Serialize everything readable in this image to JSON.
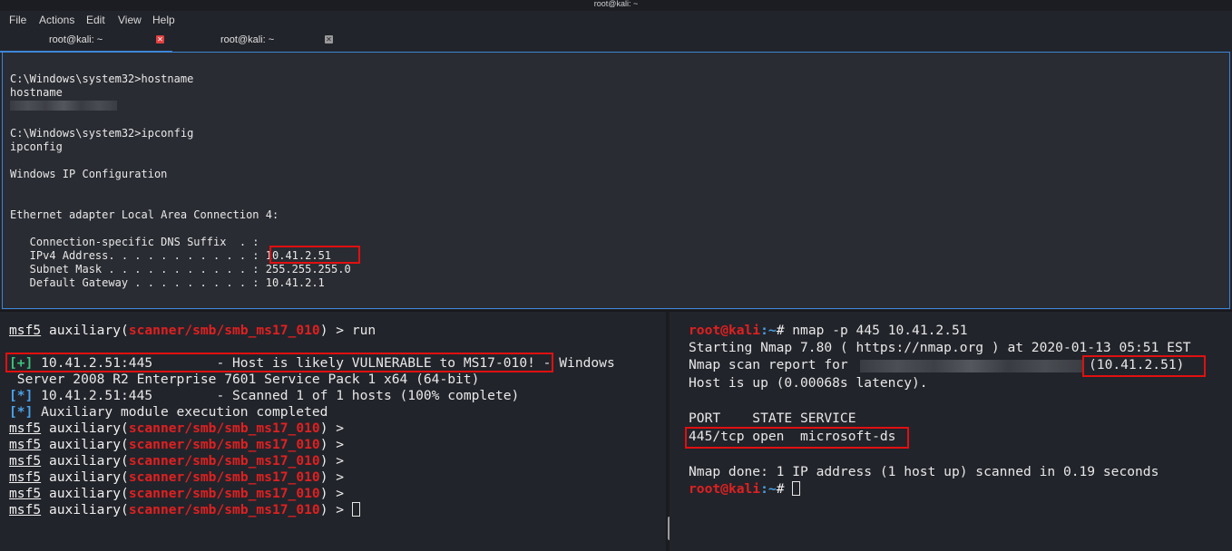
{
  "window": {
    "title": "root@kali: ~"
  },
  "menu": {
    "file": "File",
    "actions": "Actions",
    "edit": "Edit",
    "view": "View",
    "help": "Help"
  },
  "tabs": [
    {
      "label": "root@kali: ~",
      "close_color": "#e04040"
    },
    {
      "label": "root@kali: ~",
      "close_color": "#9a9a9a"
    }
  ],
  "top": {
    "l1": "C:\\Windows\\system32>hostname",
    "l2": "hostname",
    "l3": "C:\\Windows\\system32>ipconfig",
    "l4": "ipconfig",
    "l5": "Windows IP Configuration",
    "l6": "Ethernet adapter Local Area Connection 4:",
    "l7": "   Connection-specific DNS Suffix  . :",
    "l8_label": "   IPv4 Address. . . . . . . . . . . : ",
    "l8_value": "10.41.2.51",
    "l9": "   Subnet Mask . . . . . . . . . . . : 255.255.255.0",
    "l10": "   Default Gateway . . . . . . . . . : 10.41.2.1"
  },
  "left": {
    "prompt_pre": "msf5",
    "prompt_mid": " auxiliary(",
    "module": "scanner/smb/smb_ms17_010",
    "prompt_end": ") > ",
    "run_cmd": "run",
    "plus": "[+]",
    "vuln_text": " 10.41.2.51:445        - Host is likely VULNERABLE to MS17-010!",
    "vuln_tail": " - Windows",
    "vuln_line2": " Server 2008 R2 Enterprise 7601 Service Pack 1 x64 (64-bit)",
    "star": "[*]",
    "scanned": " 10.41.2.51:445        - Scanned 1 of 1 hosts (100% complete)",
    "completed": " Auxiliary module execution completed"
  },
  "right": {
    "user": "root",
    "at": "@",
    "host": "kali",
    "path": ":~",
    "hash": "# ",
    "cmd": "nmap -p 445 10.41.2.51",
    "starting": "Starting Nmap 7.80 ( https://nmap.org ) at 2020-01-13 05:51 EST",
    "report": "Nmap scan report for",
    "report_ip": "(10.41.2.51)",
    "hostup": "Host is up (0.00068s latency).",
    "header": "PORT    STATE SERVICE",
    "portline": "445/tcp open  microsoft-ds",
    "done": "Nmap done: 1 IP address (1 host up) scanned in 0.19 seconds"
  }
}
